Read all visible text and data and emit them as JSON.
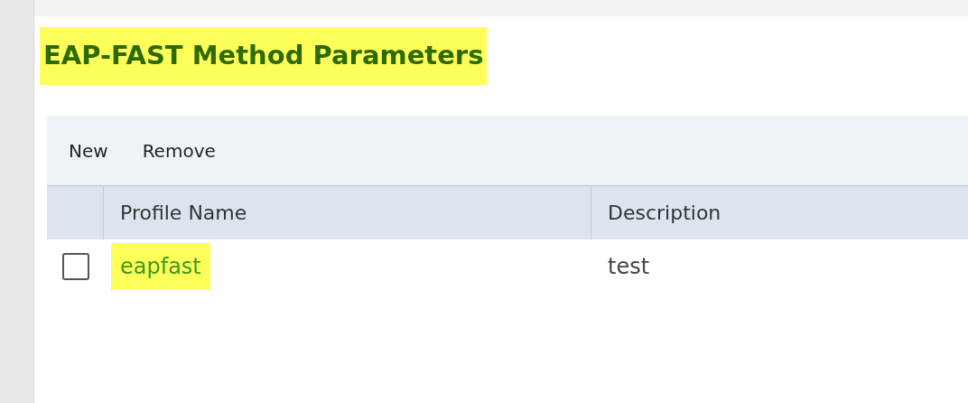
{
  "title": {
    "text": "EAP-FAST Method Parameters",
    "highlighted": true
  },
  "toolbar": [
    "New",
    "Remove"
  ],
  "table": {
    "columns": [
      "Profile Name",
      "Description"
    ],
    "rows": [
      {
        "checked": false,
        "profile_name": "eapfast",
        "profile_highlighted": true,
        "description": "test"
      }
    ]
  }
}
